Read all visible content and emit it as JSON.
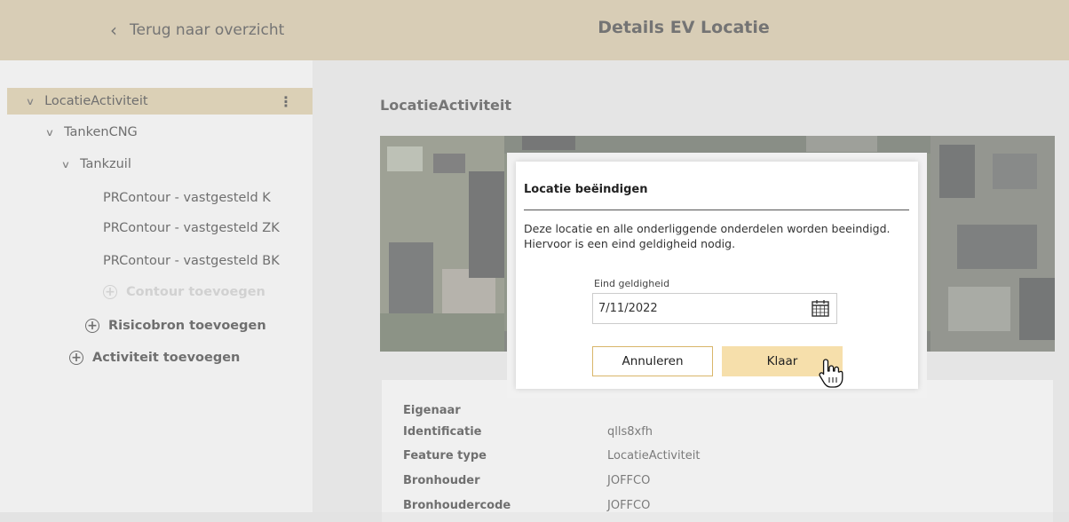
{
  "header": {
    "back_label": "Terug naar overzicht",
    "title": "Details EV Locatie"
  },
  "tree": {
    "root": {
      "label": "LocatieActiviteit",
      "menu_icon": "kebab-icon"
    },
    "level1": {
      "label": "TankenCNG"
    },
    "level2": {
      "label": "Tankzuil"
    },
    "contours": [
      "PRContour - vastgesteld K",
      "PRContour - vastgesteld ZK",
      "PRContour - vastgesteld BK"
    ],
    "add_contour": "Contour toevoegen",
    "add_risicobron": "Risicobron toevoegen",
    "add_activiteit": "Activiteit toevoegen"
  },
  "main": {
    "section_title": "LocatieActiviteit",
    "properties": [
      {
        "label": "Eigenaar",
        "value": ""
      },
      {
        "label": "Identificatie",
        "value": "qlls8xfh"
      },
      {
        "label": "Feature type",
        "value": "LocatieActiviteit"
      },
      {
        "label": "Bronhouder",
        "value": "JOFFCO"
      },
      {
        "label": "Bronhoudercode",
        "value": "JOFFCO"
      }
    ]
  },
  "modal": {
    "title": "Locatie beëindigen",
    "message": "Deze locatie en alle onderliggende onderdelen worden beeindigd. Hiervoor is een eind geldigheid nodig.",
    "field_label": "Eind geldigheid",
    "field_value": "7/11/2022",
    "cancel_label": "Annuleren",
    "confirm_label": "Klaar"
  },
  "colors": {
    "header_bg": "#c4b290",
    "selected_bg": "#c8b790",
    "confirm_bg": "#f6dfab",
    "cancel_border": "#d9b66a"
  }
}
